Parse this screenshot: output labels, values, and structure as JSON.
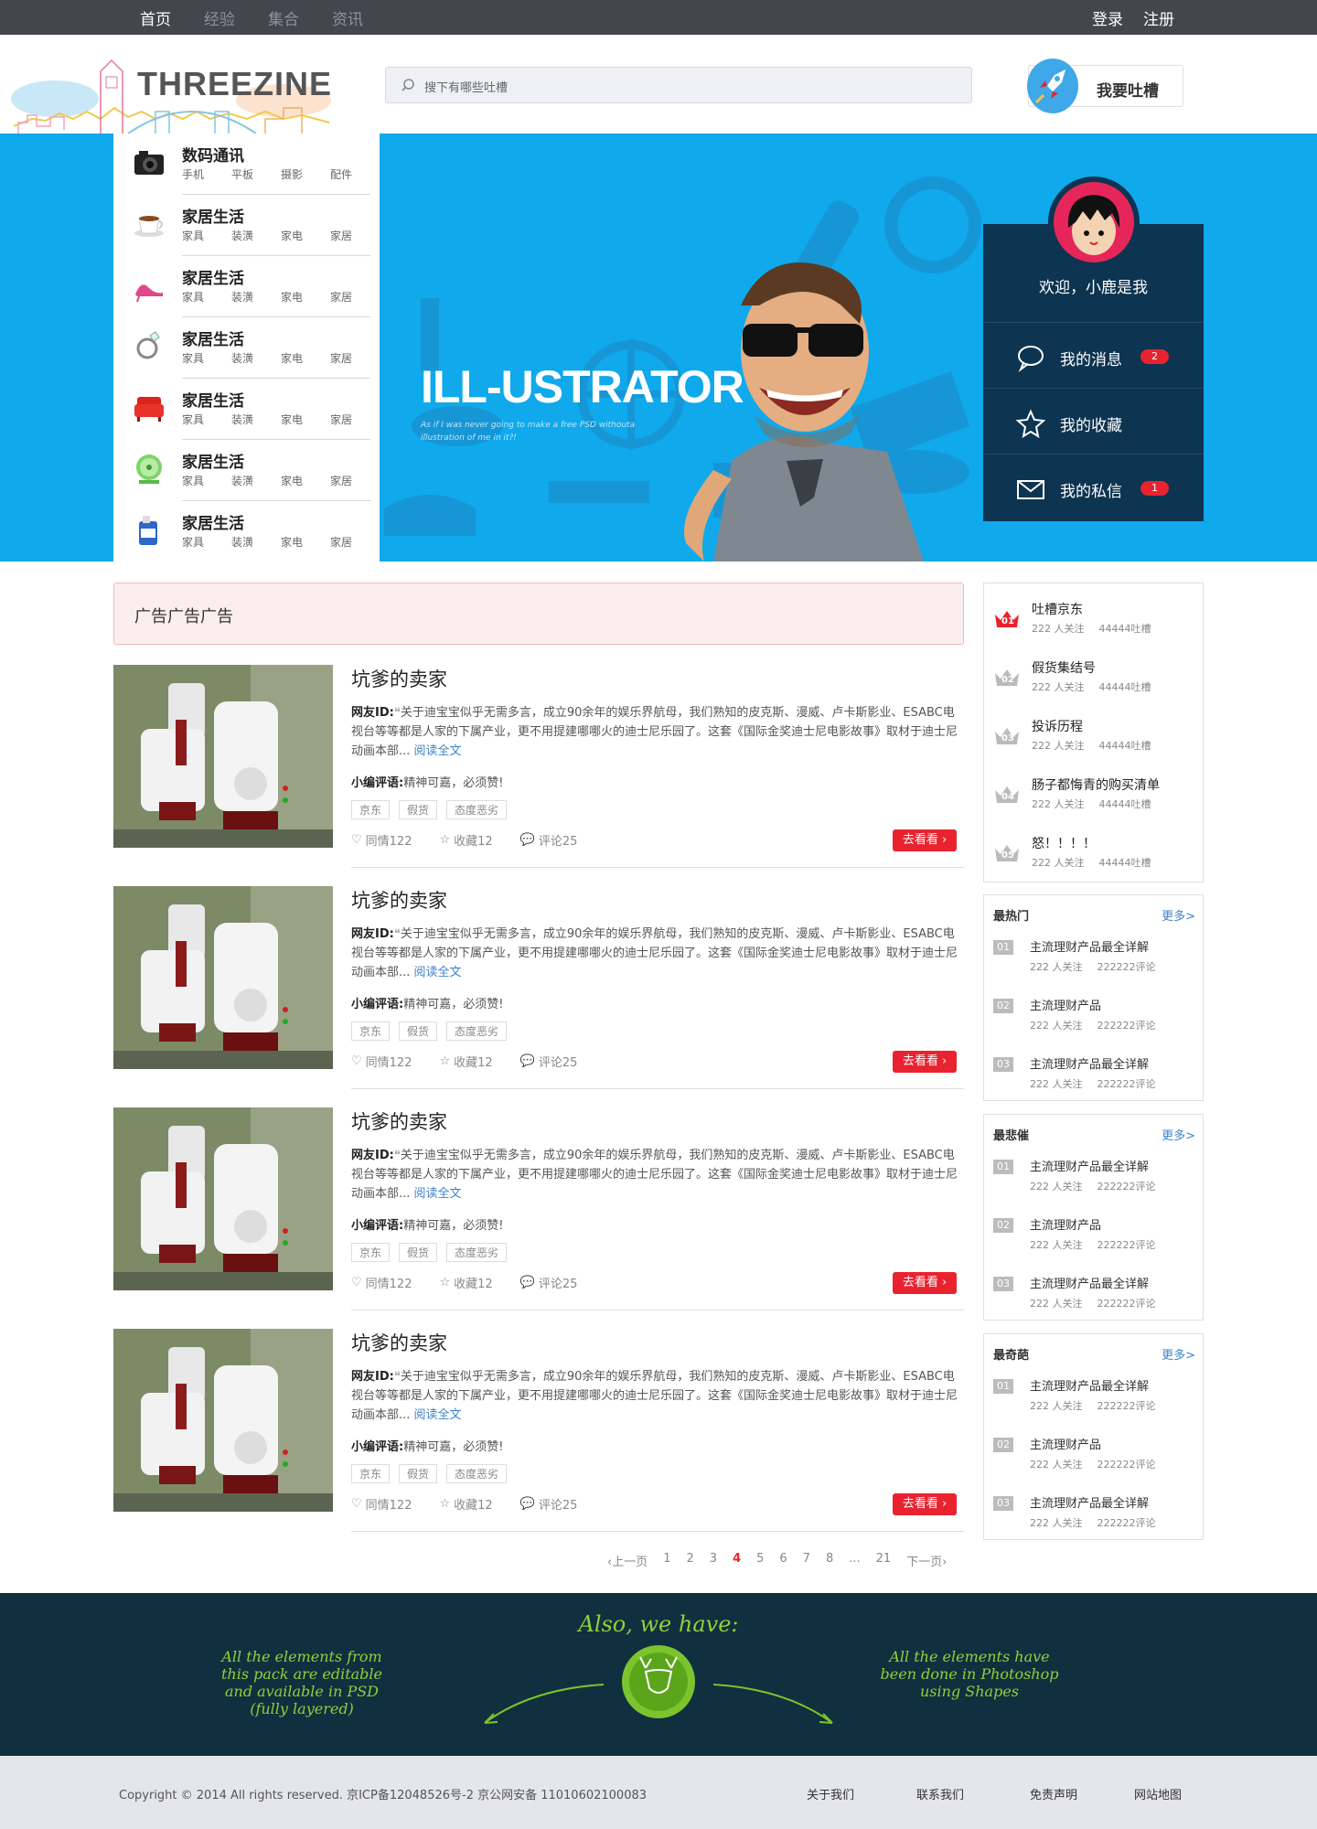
{
  "topnav": {
    "links": [
      "首页",
      "经验",
      "集合",
      "资讯"
    ],
    "login": "登录",
    "register": "注册"
  },
  "header": {
    "logo_text": "THREEZINE",
    "search_placeholder": "搜下有哪些吐槽",
    "tucao_button": "我要吐槽"
  },
  "categories": [
    {
      "title": "数码通讯",
      "subs": [
        "手机",
        "平板",
        "摄影",
        "配件"
      ],
      "icon": "camera-icon"
    },
    {
      "title": "家居生活",
      "subs": [
        "家具",
        "装潢",
        "家电",
        "家居"
      ],
      "icon": "cup-icon"
    },
    {
      "title": "家居生活",
      "subs": [
        "家具",
        "装潢",
        "家电",
        "家居"
      ],
      "icon": "shoe-icon"
    },
    {
      "title": "家居生活",
      "subs": [
        "家具",
        "装潢",
        "家电",
        "家居"
      ],
      "icon": "ring-icon"
    },
    {
      "title": "家居生活",
      "subs": [
        "家具",
        "装潢",
        "家电",
        "家居"
      ],
      "icon": "sofa-icon"
    },
    {
      "title": "家居生活",
      "subs": [
        "家具",
        "装潢",
        "家电",
        "家居"
      ],
      "icon": "fan-icon"
    },
    {
      "title": "家居生活",
      "subs": [
        "家具",
        "装潢",
        "家电",
        "家居"
      ],
      "icon": "bottle-icon"
    }
  ],
  "banner": {
    "title": "ILL-USTRATOR",
    "subtitle": "As if I was never going to make a free PSD withouta illustration of me in it?!"
  },
  "user": {
    "welcome": "欢迎，小鹿是我",
    "messages_label": "我的消息",
    "messages_count": "2",
    "favorites_label": "我的收藏",
    "private_label": "我的私信",
    "private_count": "1"
  },
  "ad_text": "广告广告广告",
  "posts": [
    {
      "title": "坑爹的卖家",
      "author_label": "网友ID:",
      "body": "关于迪宝宝似乎无需多言，成立90余年的娱乐界航母，我们熟知的皮克斯、漫威、卢卡斯影业、ESABC电视台等等都是人家的下属产业，更不用提建哪哪火的迪士尼乐园了。这套《国际金奖迪士尼电影故事》取材于迪士尼动画本部...",
      "read_more": "阅读全文",
      "comment_label": "小编评语:",
      "comment": "精神可嘉，必须赞!",
      "tags": [
        "京东",
        "假货",
        "态度恶劣"
      ],
      "likes": "同情122",
      "favs": "收藏12",
      "comments": "评论25",
      "go": "去看看"
    },
    {
      "title": "坑爹的卖家",
      "author_label": "网友ID:",
      "body": "关于迪宝宝似乎无需多言，成立90余年的娱乐界航母，我们熟知的皮克斯、漫威、卢卡斯影业、ESABC电视台等等都是人家的下属产业，更不用提建哪哪火的迪士尼乐园了。这套《国际金奖迪士尼电影故事》取材于迪士尼动画本部...",
      "read_more": "阅读全文",
      "comment_label": "小编评语:",
      "comment": "精神可嘉，必须赞!",
      "tags": [
        "京东",
        "假货",
        "态度恶劣"
      ],
      "likes": "同情122",
      "favs": "收藏12",
      "comments": "评论25",
      "go": "去看看"
    },
    {
      "title": "坑爹的卖家",
      "author_label": "网友ID:",
      "body": "关于迪宝宝似乎无需多言，成立90余年的娱乐界航母，我们熟知的皮克斯、漫威、卢卡斯影业、ESABC电视台等等都是人家的下属产业，更不用提建哪哪火的迪士尼乐园了。这套《国际金奖迪士尼电影故事》取材于迪士尼动画本部...",
      "read_more": "阅读全文",
      "comment_label": "小编评语:",
      "comment": "精神可嘉，必须赞!",
      "tags": [
        "京东",
        "假货",
        "态度恶劣"
      ],
      "likes": "同情122",
      "favs": "收藏12",
      "comments": "评论25",
      "go": "去看看"
    },
    {
      "title": "坑爹的卖家",
      "author_label": "网友ID:",
      "body": "关于迪宝宝似乎无需多言，成立90余年的娱乐界航母，我们熟知的皮克斯、漫威、卢卡斯影业、ESABC电视台等等都是人家的下属产业，更不用提建哪哪火的迪士尼乐园了。这套《国际金奖迪士尼电影故事》取材于迪士尼动画本部...",
      "read_more": "阅读全文",
      "comment_label": "小编评语:",
      "comment": "精神可嘉，必须赞!",
      "tags": [
        "京东",
        "假货",
        "态度恶劣"
      ],
      "likes": "同情122",
      "favs": "收藏12",
      "comments": "评论25",
      "go": "去看看"
    }
  ],
  "pager": {
    "prev": "上一页",
    "pages": [
      "1",
      "2",
      "3",
      "4",
      "5",
      "6",
      "7",
      "8",
      "...",
      "21"
    ],
    "current": "4",
    "next": "下一页"
  },
  "ranking": [
    {
      "num": "01",
      "name": "吐槽京东",
      "follow": "222 人关注",
      "count": "44444吐槽"
    },
    {
      "num": "02",
      "name": "假货集结号",
      "follow": "222 人关注",
      "count": "44444吐槽"
    },
    {
      "num": "03",
      "name": "投诉历程",
      "follow": "222 人关注",
      "count": "44444吐槽"
    },
    {
      "num": "04",
      "name": "肠子都悔青的购买清单",
      "follow": "222 人关注",
      "count": "44444吐槽"
    },
    {
      "num": "05",
      "name": "怒！！！！",
      "follow": "222 人关注",
      "count": "44444吐槽"
    }
  ],
  "lists": [
    {
      "header": "最热门",
      "more": "更多>",
      "items": [
        {
          "num": "01",
          "name": "主流理财产品最全详解",
          "follow": "222 人关注",
          "count": "222222评论"
        },
        {
          "num": "02",
          "name": "主流理财产品",
          "follow": "222 人关注",
          "count": "222222评论"
        },
        {
          "num": "03",
          "name": "主流理财产品最全详解",
          "follow": "222 人关注",
          "count": "222222评论"
        }
      ]
    },
    {
      "header": "最悲催",
      "more": "更多>",
      "items": [
        {
          "num": "01",
          "name": "主流理财产品最全详解",
          "follow": "222 人关注",
          "count": "222222评论"
        },
        {
          "num": "02",
          "name": "主流理财产品",
          "follow": "222 人关注",
          "count": "222222评论"
        },
        {
          "num": "03",
          "name": "主流理财产品最全详解",
          "follow": "222 人关注",
          "count": "222222评论"
        }
      ]
    },
    {
      "header": "最奇葩",
      "more": "更多>",
      "items": [
        {
          "num": "01",
          "name": "主流理财产品最全详解",
          "follow": "222 人关注",
          "count": "222222评论"
        },
        {
          "num": "02",
          "name": "主流理财产品",
          "follow": "222 人关注",
          "count": "222222评论"
        },
        {
          "num": "03",
          "name": "主流理财产品最全详解",
          "follow": "222 人关注",
          "count": "222222评论"
        }
      ]
    }
  ],
  "feature": {
    "title": "Also, we have:",
    "left": "All the elements from this pack are editable and available in PSD (fully layered)",
    "right": "All the elements have been done in Photoshop using Shapes"
  },
  "footer": {
    "copyright": "Copyright © 2014 All rights reserved. 京ICP备12048526号-2 京公网安备 11010602100083",
    "links": [
      "关于我们",
      "联系我们",
      "免责声明",
      "网站地图"
    ]
  },
  "colors": {
    "accent_red": "#e8232f",
    "banner_blue": "#0fa9ec",
    "dark_navy": "#0d3450",
    "link_blue": "#3d84c9"
  }
}
